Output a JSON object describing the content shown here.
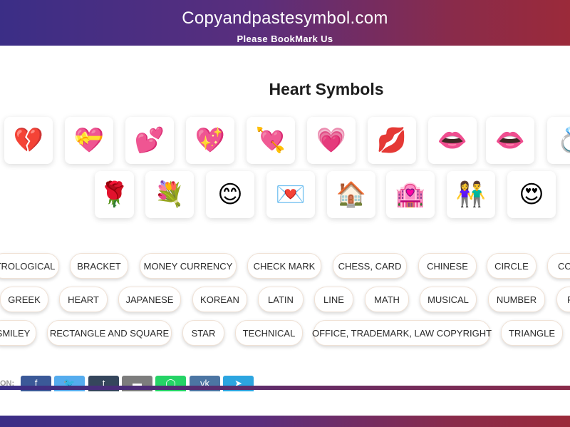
{
  "header": {
    "site_title": "Copyandpastesymbol.com",
    "subtitle": "Please BookMark Us"
  },
  "page_title": "Heart Symbols",
  "symbols_row1": [
    "💔",
    "💝",
    "💕",
    "💖",
    "💘",
    "💗",
    "💋",
    "👄",
    "💍"
  ],
  "symbols_row2": [
    "🌹",
    "💐",
    "😊",
    "💌",
    "🏠",
    "🏩",
    "👫",
    "😍"
  ],
  "categories_row1": [
    "TROLOGICAL",
    "BRACKET",
    "MONEY CURRENCY",
    "CHECK MARK",
    "CHESS, CARD",
    "CHINESE",
    "CIRCLE",
    "CO"
  ],
  "categories_row2": [
    "GREEK",
    "HEART",
    "JAPANESE",
    "KOREAN",
    "LATIN",
    "LINE",
    "MATH",
    "MUSICAL",
    "NUMBER",
    "P"
  ],
  "categories_row3": [
    "SMILEY",
    "RECTANGLE AND SQUARE",
    "STAR",
    "TECHNICAL",
    "OFFICE, TRADEMARK, LAW COPYRIGHT",
    "TRIANGLE"
  ],
  "share": {
    "label": "ON:",
    "buttons": [
      {
        "name": "facebook",
        "glyph": "f",
        "color": "#3b5998"
      },
      {
        "name": "twitter",
        "glyph": "🐦",
        "color": "#55acee"
      },
      {
        "name": "tumblr",
        "glyph": "t",
        "color": "#35465c"
      },
      {
        "name": "email",
        "glyph": "▬",
        "color": "#7d7d7d"
      },
      {
        "name": "whatsapp",
        "glyph": "◯",
        "color": "#25d366"
      },
      {
        "name": "vk",
        "glyph": "vk",
        "color": "#4c75a3"
      },
      {
        "name": "telegram",
        "glyph": "➤",
        "color": "#2ca5e0"
      }
    ]
  }
}
